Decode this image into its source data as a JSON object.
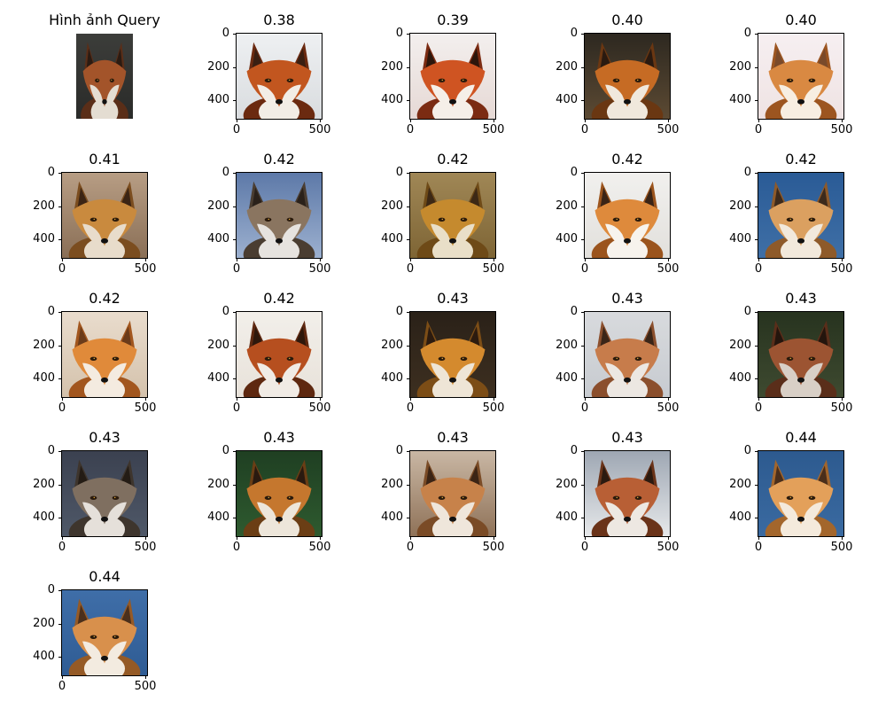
{
  "query": {
    "title": "Hình ảnh Query",
    "palette": {
      "bg_top": "#3c3d3a",
      "bg_bottom": "#2a2b29",
      "fur": "#a3542a",
      "fur_dark": "#5a2e18",
      "muzzle": "#e4ddd2",
      "ear_inner": "#2b1b12"
    }
  },
  "axis_ticks": {
    "y": [
      "0",
      "200",
      "400"
    ],
    "x": [
      "0",
      "500"
    ]
  },
  "results": [
    {
      "score": "0.38",
      "palette": {
        "bg_top": "#eef0f2",
        "bg_bottom": "#d9dcdf",
        "fur": "#c2561f",
        "fur_dark": "#6b2a10",
        "muzzle": "#f2ede6",
        "ear_inner": "#3a1f12"
      }
    },
    {
      "score": "0.39",
      "palette": {
        "bg_top": "#f3efee",
        "bg_bottom": "#e6d9d5",
        "fur": "#cf5422",
        "fur_dark": "#7b2b12",
        "muzzle": "#f5efe8",
        "ear_inner": "#2c160c"
      }
    },
    {
      "score": "0.40",
      "palette": {
        "bg_top": "#2d2820",
        "bg_bottom": "#5c4a33",
        "fur": "#c66b24",
        "fur_dark": "#6a3712",
        "muzzle": "#f0e8dc",
        "ear_inner": "#2a1a10"
      }
    },
    {
      "score": "0.40",
      "palette": {
        "bg_top": "#f6eff1",
        "bg_bottom": "#efe3e3",
        "fur": "#d98942",
        "fur_dark": "#9c5520",
        "muzzle": "#f7eee2",
        "ear_inner": "#7a4a2a"
      }
    },
    {
      "score": "0.41",
      "palette": {
        "bg_top": "#b79d84",
        "bg_bottom": "#8a6f56",
        "fur": "#c98a3e",
        "fur_dark": "#7b4d1f",
        "muzzle": "#e8dccb",
        "ear_inner": "#3b2414"
      }
    },
    {
      "score": "0.42",
      "palette": {
        "bg_top": "#5d79a8",
        "bg_bottom": "#9cb0cf",
        "fur": "#8a7560",
        "fur_dark": "#4a3d31",
        "muzzle": "#e6e3df",
        "ear_inner": "#2a211a"
      }
    },
    {
      "score": "0.42",
      "palette": {
        "bg_top": "#a08756",
        "bg_bottom": "#7e6535",
        "fur": "#c58a2e",
        "fur_dark": "#6e4a17",
        "muzzle": "#e9dfc8",
        "ear_inner": "#3c2815"
      }
    },
    {
      "score": "0.42",
      "palette": {
        "bg_top": "#f1f0ee",
        "bg_bottom": "#e2e0dc",
        "fur": "#de8a3c",
        "fur_dark": "#9b541d",
        "muzzle": "#f7f3ed",
        "ear_inner": "#3a2416"
      }
    },
    {
      "score": "0.42",
      "palette": {
        "bg_top": "#2a5b96",
        "bg_bottom": "#3f6fa6",
        "fur": "#dba060",
        "fur_dark": "#8e5a2a",
        "muzzle": "#f2e9dc",
        "ear_inner": "#3c2a1c"
      }
    },
    {
      "score": "0.42",
      "palette": {
        "bg_top": "#e9dccd",
        "bg_bottom": "#d4c2ac",
        "fur": "#e08a3a",
        "fur_dark": "#a2561e",
        "muzzle": "#f4ebe0",
        "ear_inner": "#6b3b1a"
      }
    },
    {
      "score": "0.42",
      "palette": {
        "bg_top": "#f2efea",
        "bg_bottom": "#e8e2da",
        "fur": "#b64f1f",
        "fur_dark": "#5e2810",
        "muzzle": "#f0ebe5",
        "ear_inner": "#2e180c"
      }
    },
    {
      "score": "0.43",
      "palette": {
        "bg_top": "#2a2118",
        "bg_bottom": "#3d2f20",
        "fur": "#d48a2e",
        "fur_dark": "#7c4d16",
        "muzzle": "#eee5d6",
        "ear_inner": "#2c1b0f"
      }
    },
    {
      "score": "0.43",
      "palette": {
        "bg_top": "#d8dadd",
        "bg_bottom": "#c7cbd0",
        "fur": "#c77c4b",
        "fur_dark": "#8b4f2d",
        "muzzle": "#ece7e2",
        "ear_inner": "#3a2518"
      }
    },
    {
      "score": "0.43",
      "palette": {
        "bg_top": "#27331f",
        "bg_bottom": "#3e4a30",
        "fur": "#9c5432",
        "fur_dark": "#5a2e1a",
        "muzzle": "#d8cfc6",
        "ear_inner": "#24150d"
      }
    },
    {
      "score": "0.43",
      "palette": {
        "bg_top": "#3b4150",
        "bg_bottom": "#4f5868",
        "fur": "#7f6f60",
        "fur_dark": "#3e352d",
        "muzzle": "#e5e0da",
        "ear_inner": "#241c15"
      }
    },
    {
      "score": "0.43",
      "palette": {
        "bg_top": "#1f3f22",
        "bg_bottom": "#2e5a2f",
        "fur": "#c5772e",
        "fur_dark": "#6b3e15",
        "muzzle": "#ede6da",
        "ear_inner": "#2a1a10"
      }
    },
    {
      "score": "0.43",
      "palette": {
        "bg_top": "#c9b7a4",
        "bg_bottom": "#8f7258",
        "fur": "#c7824a",
        "fur_dark": "#7a4b26",
        "muzzle": "#efe6db",
        "ear_inner": "#3b2415"
      }
    },
    {
      "score": "0.43",
      "palette": {
        "bg_top": "#9ea7b3",
        "bg_bottom": "#e6e8ea",
        "fur": "#b85f35",
        "fur_dark": "#6a3319",
        "muzzle": "#ede8e2",
        "ear_inner": "#2b1a10"
      }
    },
    {
      "score": "0.44",
      "palette": {
        "bg_top": "#2d5a8f",
        "bg_bottom": "#3a6aa1",
        "fur": "#e3a05a",
        "fur_dark": "#a3662c",
        "muzzle": "#f4eadc",
        "ear_inner": "#4a2e1a"
      }
    },
    {
      "score": "0.44",
      "palette": {
        "bg_top": "#3f6ea8",
        "bg_bottom": "#2f5c94",
        "fur": "#d8904c",
        "fur_dark": "#955a26",
        "muzzle": "#f3ebe0",
        "ear_inner": "#4b2f1b"
      }
    }
  ]
}
